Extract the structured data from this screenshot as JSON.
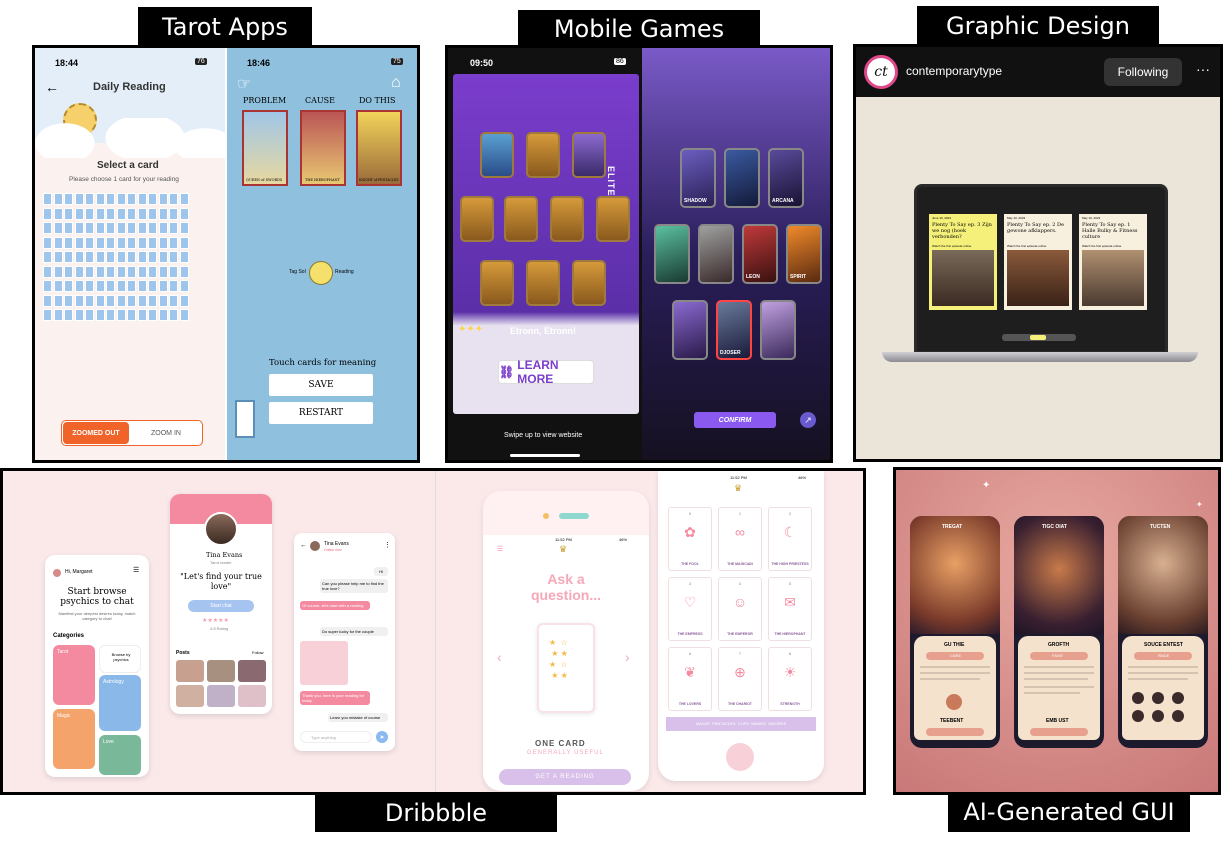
{
  "labels": {
    "tarot": "Tarot Apps",
    "games": "Mobile Games",
    "graphic": "Graphic Design",
    "dribbble": "Dribbble",
    "ai": "AI-Generated GUI"
  },
  "tarot": {
    "left": {
      "time": "18:44",
      "battery": "76",
      "title": "Daily Reading",
      "heading": "Select a card",
      "subheading": "Please choose 1 card for your reading",
      "zoom_out": "ZOOMED OUT",
      "zoom_in": "ZOOM IN"
    },
    "right": {
      "time": "18:46",
      "battery": "75",
      "col1": "PROBLEM",
      "col2": "CAUSE",
      "col3": "DO THIS",
      "card1": "QUEEN of SWORDS",
      "card2": "THE HIEROPHANT",
      "card3": "KNIGHT of PENTACLES",
      "left_side": "Tag Sol",
      "right_side": "Reading",
      "hint": "Touch cards for meaning",
      "save": "SAVE",
      "restart": "RESTART"
    }
  },
  "games": {
    "time": "09:50",
    "battery": "86",
    "elite": "ELITE",
    "caption": "Etronn, Etronn!",
    "learn_more": "LEARN MORE",
    "swipe": "Swipe up to view website",
    "confirm": "CONFIRM",
    "heroes": [
      "SHADOW",
      "",
      "ARCANA",
      "",
      "",
      "LEON",
      "SPIRIT",
      "",
      "DJOSER",
      ""
    ]
  },
  "graphic": {
    "username": "contemporarytype",
    "logo": "ct",
    "follow": "Following",
    "more": "···",
    "cards": [
      {
        "date": "June 16, 2023",
        "title": "Plenty To Say ep. 3 Zijn we nog (hoek verbonden?",
        "link": "Watch the first episode online"
      },
      {
        "date": "May 10, 2023",
        "title": "Plenty To Say ep. 2 De gewone afklappers.",
        "link": "Watch the first episode online"
      },
      {
        "date": "May 10, 2023",
        "title": "Plenty To Say ep. 1 Halle Bulky & Fitness culture",
        "link": "Watch the first episode online"
      }
    ]
  },
  "dribbble": {
    "app1": {
      "greeting": "Hi, Margaret",
      "title": "Start browse psychics to chat",
      "desc": "Manifest your deepest desires today, match category to chat!",
      "categories": "Categories",
      "cat1": "Tarot",
      "cat2": "Browse by psychics",
      "cat3": "Astrology",
      "cat4": "Magic",
      "cat5": "Love"
    },
    "app2": {
      "name": "Tina Evans",
      "role": "Tarot reader",
      "quote": "\"Let's find your true love\"",
      "button": "Start chat",
      "rating": "4.8 Rating",
      "posts": "Posts",
      "follow": "Follow",
      "stars": "★★★★★"
    },
    "app3": {
      "name": "Tina Evans",
      "status": "Online now",
      "m1": "Hi",
      "m2": "Can you please help me to find the true love?",
      "m3": "Of course, let's start with a reading",
      "m4": "Do super lucky for the couple",
      "m5": "Thank you, here is your reading for today",
      "m6": "Learn you mistake of course",
      "input": "Type anything"
    },
    "app4": {
      "time": "11:52 PM",
      "battery": "46%",
      "ask": "Ask a question...",
      "card_label": "ONE CARD",
      "card_sub": "GENERALLY USEFUL",
      "button": "GET A READING"
    },
    "app5": {
      "time": "11:52 PM",
      "battery": "46%",
      "cards": [
        {
          "num": "0",
          "name": "THE FOOL"
        },
        {
          "num": "1",
          "name": "THE MAGICIAN"
        },
        {
          "num": "2",
          "name": "THE HIGH PRIESTESS"
        },
        {
          "num": "3",
          "name": "THE EMPRESS"
        },
        {
          "num": "4",
          "name": "THE EMPEROR"
        },
        {
          "num": "5",
          "name": "THE HIEROPHANT"
        },
        {
          "num": "6",
          "name": "THE LOVERS"
        },
        {
          "num": "7",
          "name": "THE CHARIOT"
        },
        {
          "num": "8",
          "name": "STRENGTH"
        }
      ],
      "suits": "MAJOR  PENTACLES  CUPS  WANDS  SWORDS"
    }
  },
  "ai": {
    "phone1": {
      "title": "TREGAT",
      "card": "GU THIE",
      "pill": "CARE",
      "bottom": "TEEBENT"
    },
    "phone2": {
      "title": "TIGC OIAT",
      "card": "GROFTH",
      "pill": "FAVIE",
      "bottom": "EMB UST"
    },
    "phone3": {
      "title": "TUCTEN",
      "card": "SOUCE ENTEST",
      "pill": "RNDE"
    }
  },
  "colors": {
    "tarot_blue": "#8fc1df",
    "orange": "#f0642a",
    "purple": "#6b3fc0",
    "pink": "#f7b7c4",
    "lilac": "#c9b4e8",
    "ai_bg": "#d48c8c"
  }
}
